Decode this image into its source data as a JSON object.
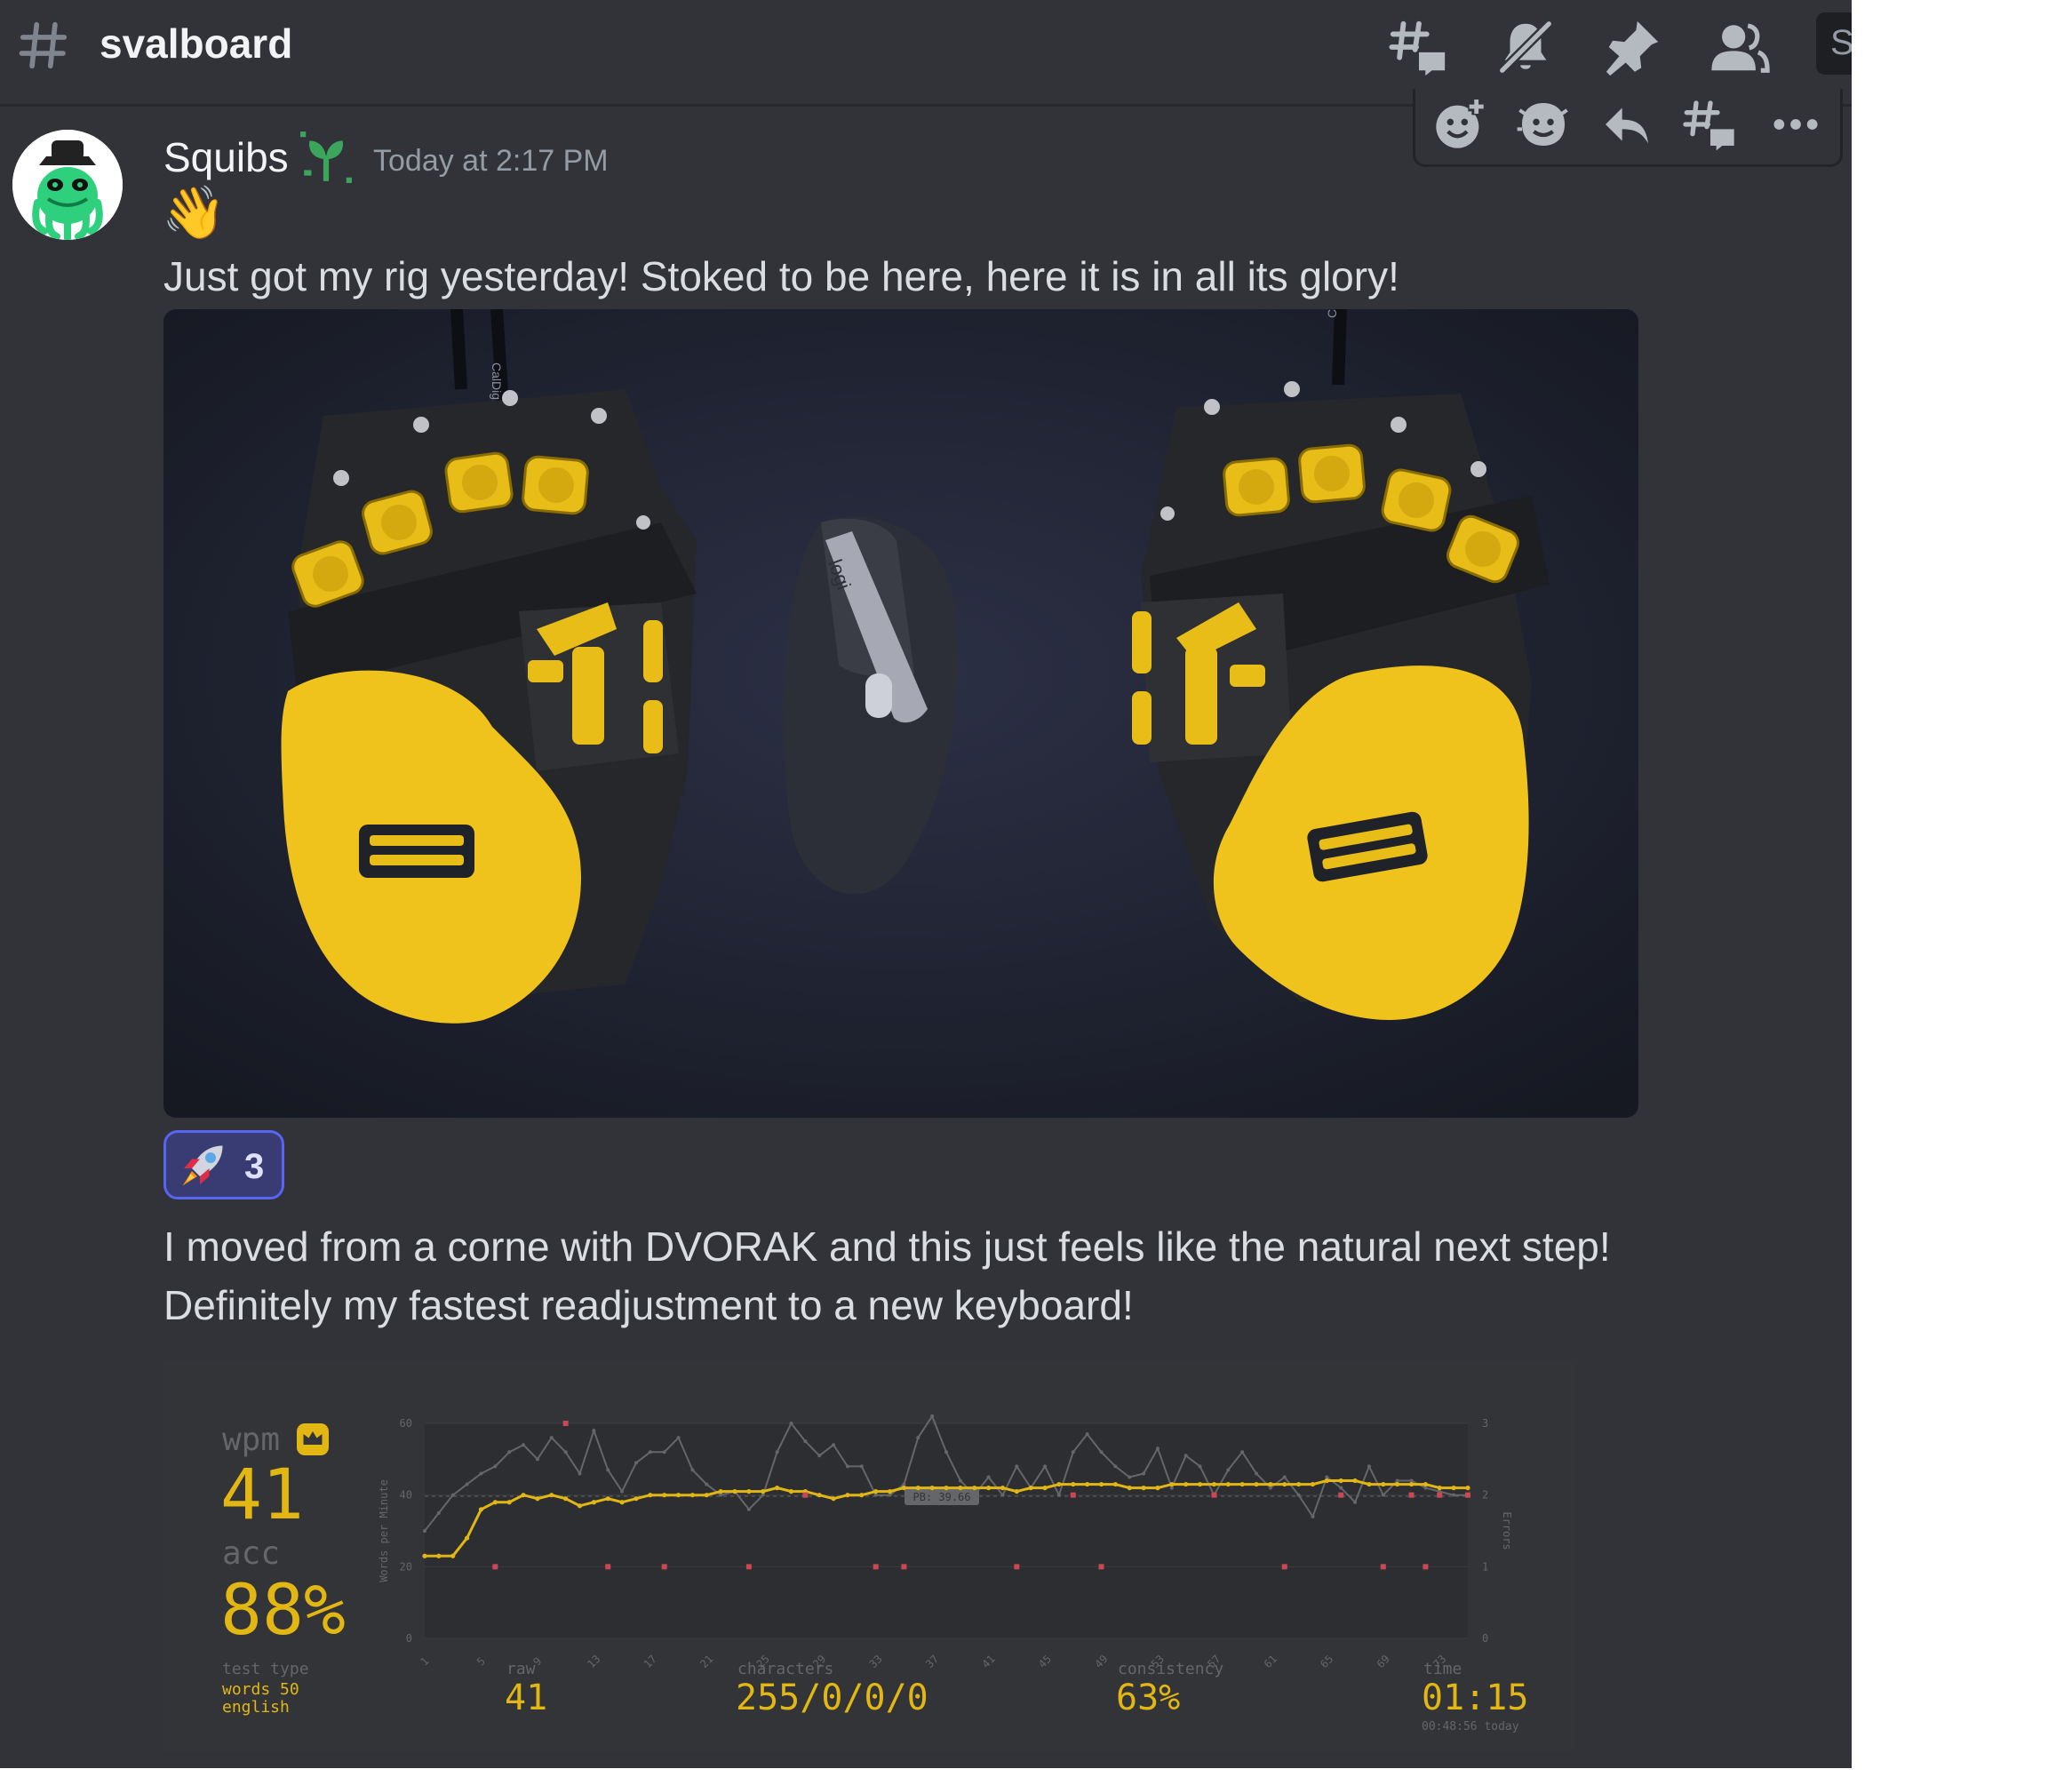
{
  "channel": {
    "name": "svalboard"
  },
  "header_icons": [
    "threads-icon",
    "mute-bell-icon",
    "pin-icon",
    "members-icon"
  ],
  "search": {
    "placeholder": "S"
  },
  "message": {
    "author": "Squibs",
    "timestamp": "Today at 2:17 PM",
    "wave_emoji": "👋",
    "text_1": "Just got my rig yesterday! Stoked to be here, here it is in all its glory!",
    "reaction": {
      "emoji": "rocket",
      "count": "3"
    },
    "text_2": "I moved from a corne with DVORAK and this just feels like the natural next step!",
    "text_3": "Definitely my fastest readjustment to a new keyboard!"
  },
  "message_actions": [
    "add-reaction-icon",
    "super-reaction-icon",
    "reply-icon",
    "create-thread-icon",
    "more-options-icon"
  ],
  "photo": {
    "cable_label_left": "CalDigit",
    "cable_label_right": "CalDigit",
    "mouse_brand": "logi"
  },
  "typing_result": {
    "wpm_label": "wpm",
    "wpm": "41",
    "acc_label": "acc",
    "acc": "88%",
    "test_type_label": "test type",
    "test_type_line1": "words 50",
    "test_type_line2": "english",
    "raw_label": "raw",
    "raw": "41",
    "characters_label": "characters",
    "characters": "255/0/0/0",
    "consistency_label": "consistency",
    "consistency": "63%",
    "time_label": "time",
    "time": "01:15",
    "time_sub": "00:48:56 today"
  },
  "chart_data": {
    "type": "line",
    "ylabel": "Words per Minute",
    "y2label": "Errors",
    "ylim": [
      0,
      60
    ],
    "y2lim": [
      0,
      3
    ],
    "yticks": [
      "0",
      "20",
      "40",
      "60"
    ],
    "y2ticks": [
      "0",
      "1",
      "2",
      "3"
    ],
    "pb_label": "PB: 39.66",
    "pb_value": 39.66,
    "xticks": [
      "1",
      "5",
      "9",
      "13",
      "17",
      "21",
      "25",
      "29",
      "33",
      "37",
      "41",
      "45",
      "49",
      "53",
      "57",
      "61",
      "65",
      "69",
      "73"
    ],
    "series": [
      {
        "name": "wpm",
        "color": "#e2b714",
        "x": [
          1,
          2,
          3,
          4,
          5,
          6,
          7,
          8,
          9,
          10,
          11,
          12,
          13,
          14,
          15,
          16,
          17,
          18,
          19,
          20,
          21,
          22,
          23,
          24,
          25,
          26,
          27,
          28,
          29,
          30,
          31,
          32,
          33,
          34,
          35,
          36,
          37,
          38,
          39,
          40,
          41,
          42,
          43,
          44,
          45,
          46,
          47,
          48,
          49,
          50,
          51,
          52,
          53,
          54,
          55,
          56,
          57,
          58,
          59,
          60,
          61,
          62,
          63,
          64,
          65,
          66,
          67,
          68,
          69,
          70,
          71,
          72,
          73,
          74,
          75
        ],
        "values": [
          23,
          23,
          23,
          28,
          36,
          38,
          38,
          40,
          39,
          40,
          39,
          37,
          38,
          39,
          38,
          39,
          40,
          40,
          40,
          40,
          40,
          41,
          41,
          41,
          41,
          42,
          41,
          41,
          40,
          39,
          40,
          40,
          41,
          41,
          42,
          42,
          42,
          42,
          42,
          42,
          42,
          42,
          41,
          42,
          42,
          43,
          43,
          43,
          43,
          43,
          42,
          42,
          42,
          43,
          43,
          43,
          43,
          43,
          43,
          43,
          43,
          43,
          43,
          43,
          44,
          44,
          44,
          43,
          43,
          43,
          43,
          43,
          42,
          42,
          42
        ]
      },
      {
        "name": "raw",
        "color": "#646669",
        "x": [
          1,
          2,
          3,
          4,
          5,
          6,
          7,
          8,
          9,
          10,
          11,
          12,
          13,
          14,
          15,
          16,
          17,
          18,
          19,
          20,
          21,
          22,
          23,
          24,
          25,
          26,
          27,
          28,
          29,
          30,
          31,
          32,
          33,
          34,
          35,
          36,
          37,
          38,
          39,
          40,
          41,
          42,
          43,
          44,
          45,
          46,
          47,
          48,
          49,
          50,
          51,
          52,
          53,
          54,
          55,
          56,
          57,
          58,
          59,
          60,
          61,
          62,
          63,
          64,
          65,
          66,
          67,
          68,
          69,
          70,
          71,
          72,
          73,
          74,
          75
        ],
        "values": [
          30,
          35,
          40,
          43,
          46,
          48,
          52,
          54,
          50,
          56,
          52,
          46,
          58,
          47,
          41,
          49,
          52,
          52,
          56,
          47,
          43,
          40,
          41,
          36,
          40,
          52,
          60,
          55,
          51,
          54,
          48,
          48,
          40,
          40,
          43,
          56,
          62,
          52,
          44,
          40,
          45,
          40,
          48,
          42,
          48,
          40,
          52,
          57,
          52,
          48,
          45,
          46,
          53,
          42,
          51,
          48,
          40,
          47,
          52,
          46,
          42,
          45,
          40,
          34,
          45,
          42,
          38,
          48,
          40,
          44,
          44,
          42,
          41,
          40,
          40
        ]
      }
    ],
    "errors": {
      "x": [
        6,
        11,
        14,
        18,
        24,
        28,
        33,
        35,
        43,
        47,
        49,
        57,
        62,
        66,
        69,
        71,
        72,
        73,
        75
      ],
      "values": [
        1,
        3,
        1,
        1,
        1,
        2,
        1,
        1,
        1,
        2,
        1,
        2,
        1,
        2,
        1,
        2,
        1,
        2,
        2
      ]
    }
  }
}
